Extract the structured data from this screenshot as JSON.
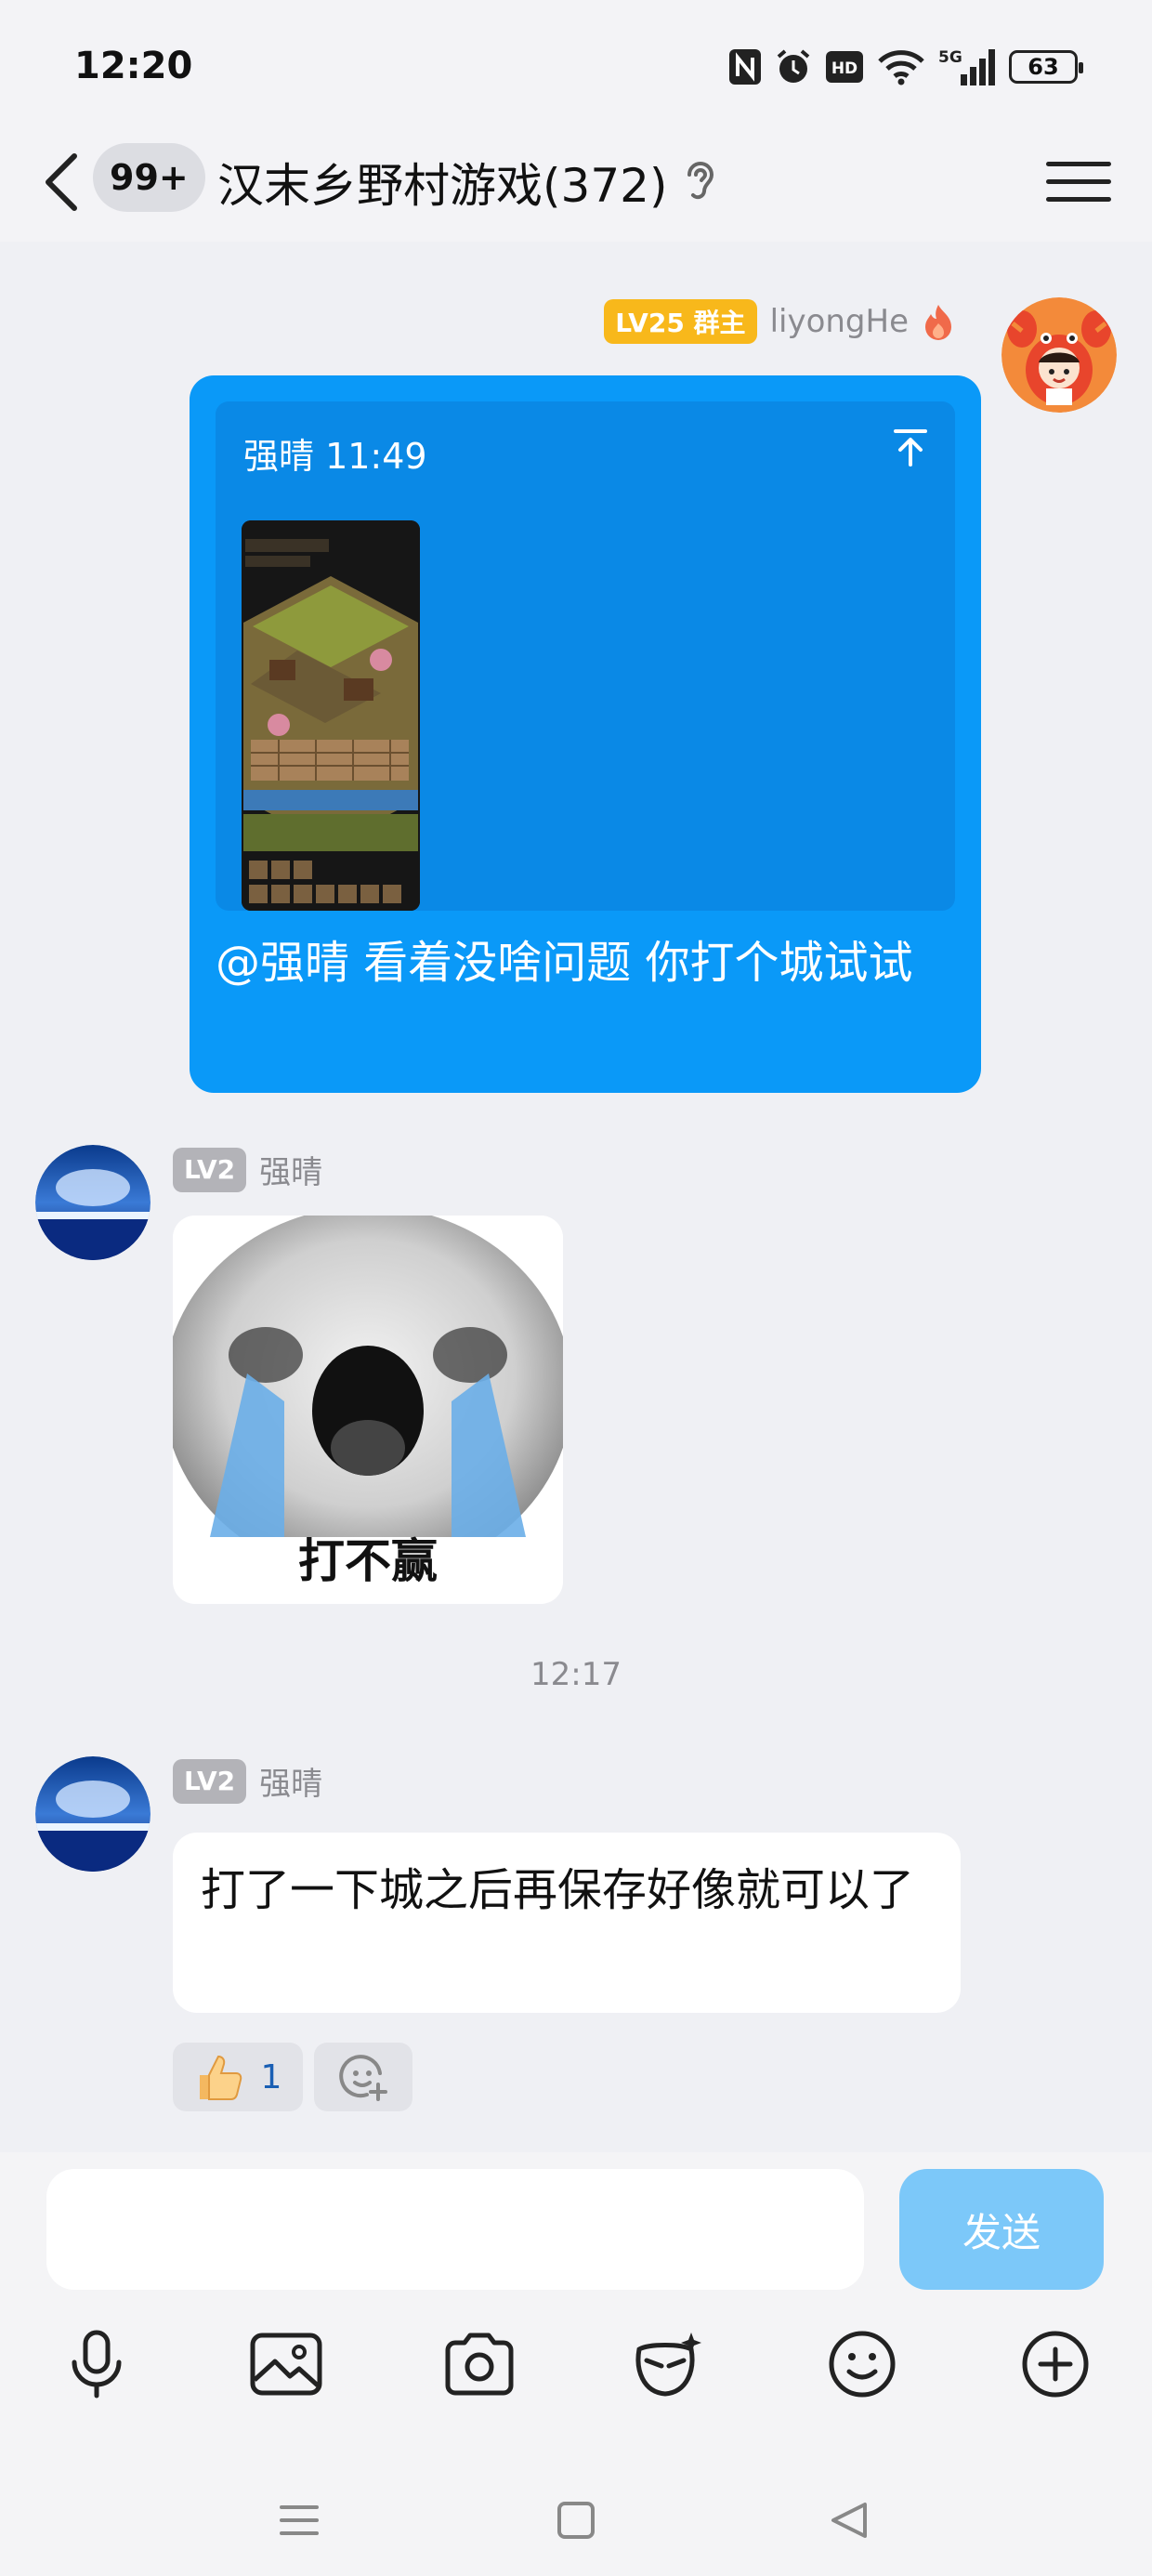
{
  "status_bar": {
    "time": "12:20",
    "icons": [
      "nfc-icon",
      "alarm-icon",
      "hd-icon",
      "wifi-icon",
      "5g-signal-icon",
      "battery-icon"
    ],
    "hd_label": "HD",
    "network_label": "5G",
    "battery_level": "63"
  },
  "header": {
    "unread_badge": "99+",
    "title": "汉末乡野村游戏(372)",
    "icons": [
      "back-arrow-icon",
      "ear-icon",
      "menu-icon"
    ]
  },
  "messages": [
    {
      "side": "right",
      "level_badge": "LV25 群主",
      "sender": "liyongHe",
      "quote": {
        "header": "强晴 11:49"
      },
      "text": "@强晴 看着没啥问题 你打个城试试"
    },
    {
      "side": "left",
      "level_badge": "LV2",
      "sender": "强晴",
      "sticker_caption": "打不赢"
    },
    {
      "side": "left",
      "level_badge": "LV2",
      "sender": "强晴",
      "text": "打了一下城之后再保存好像就可以了",
      "reactions": [
        {
          "icon": "thumbs-up-icon",
          "count": "1"
        },
        {
          "icon": "add-reaction-icon"
        }
      ]
    }
  ],
  "time_divider": "12:17",
  "composer": {
    "input_value": "",
    "send_label": "发送",
    "toolbar_icons": [
      "microphone-icon",
      "image-icon",
      "camera-icon",
      "mask-icon",
      "emoji-icon",
      "plus-icon"
    ]
  },
  "colors": {
    "bubble_blue": "#0a99f8",
    "send_button": "#7cc8f9",
    "owner_badge": "#f8b81b",
    "background": "#eff0f4"
  }
}
